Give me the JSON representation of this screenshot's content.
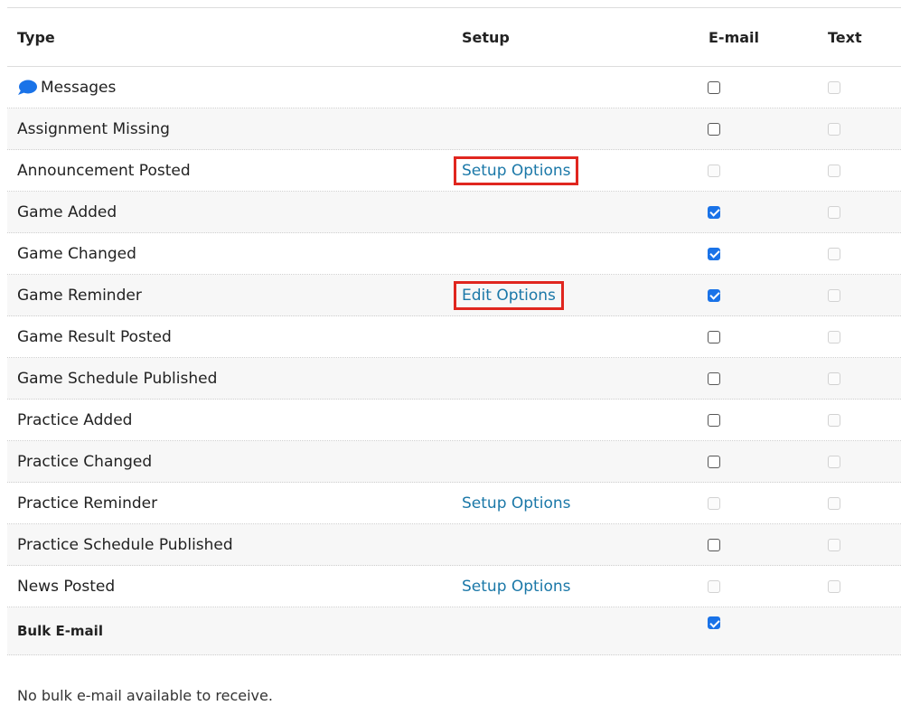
{
  "headers": {
    "type": "Type",
    "setup": "Setup",
    "email": "E-mail",
    "text": "Text"
  },
  "rows": [
    {
      "label": "Messages",
      "icon": "speech-bubble-icon",
      "setup": "",
      "email": "unchecked",
      "text": "disabled"
    },
    {
      "label": "Assignment Missing",
      "setup": "",
      "email": "unchecked",
      "text": "disabled"
    },
    {
      "label": "Announcement Posted",
      "setup": "Setup Options",
      "setup_highlighted": true,
      "email": "disabled",
      "text": "disabled"
    },
    {
      "label": "Game Added",
      "setup": "",
      "email": "checked",
      "text": "disabled"
    },
    {
      "label": "Game Changed",
      "setup": "",
      "email": "checked",
      "text": "disabled"
    },
    {
      "label": "Game Reminder",
      "setup": "Edit Options",
      "setup_highlighted": true,
      "email": "checked",
      "text": "disabled"
    },
    {
      "label": "Game Result Posted",
      "setup": "",
      "email": "unchecked",
      "text": "disabled"
    },
    {
      "label": "Game Schedule Published",
      "setup": "",
      "email": "unchecked",
      "text": "disabled"
    },
    {
      "label": "Practice Added",
      "setup": "",
      "email": "unchecked",
      "text": "disabled"
    },
    {
      "label": "Practice Changed",
      "setup": "",
      "email": "unchecked",
      "text": "disabled"
    },
    {
      "label": "Practice Reminder",
      "setup": "Setup Options",
      "email": "disabled",
      "text": "disabled"
    },
    {
      "label": "Practice Schedule Published",
      "setup": "",
      "email": "unchecked",
      "text": "disabled"
    },
    {
      "label": "News Posted",
      "setup": "Setup Options",
      "email": "disabled",
      "text": "disabled"
    }
  ],
  "bulk": {
    "label": "Bulk E-mail",
    "email": "checked"
  },
  "bulk_note": "No bulk e-mail available to receive.",
  "colors": {
    "link": "#1b78a8",
    "checkbox_on": "#1a73e8",
    "highlight": "#e0261f",
    "bubble": "#1a73e8"
  }
}
